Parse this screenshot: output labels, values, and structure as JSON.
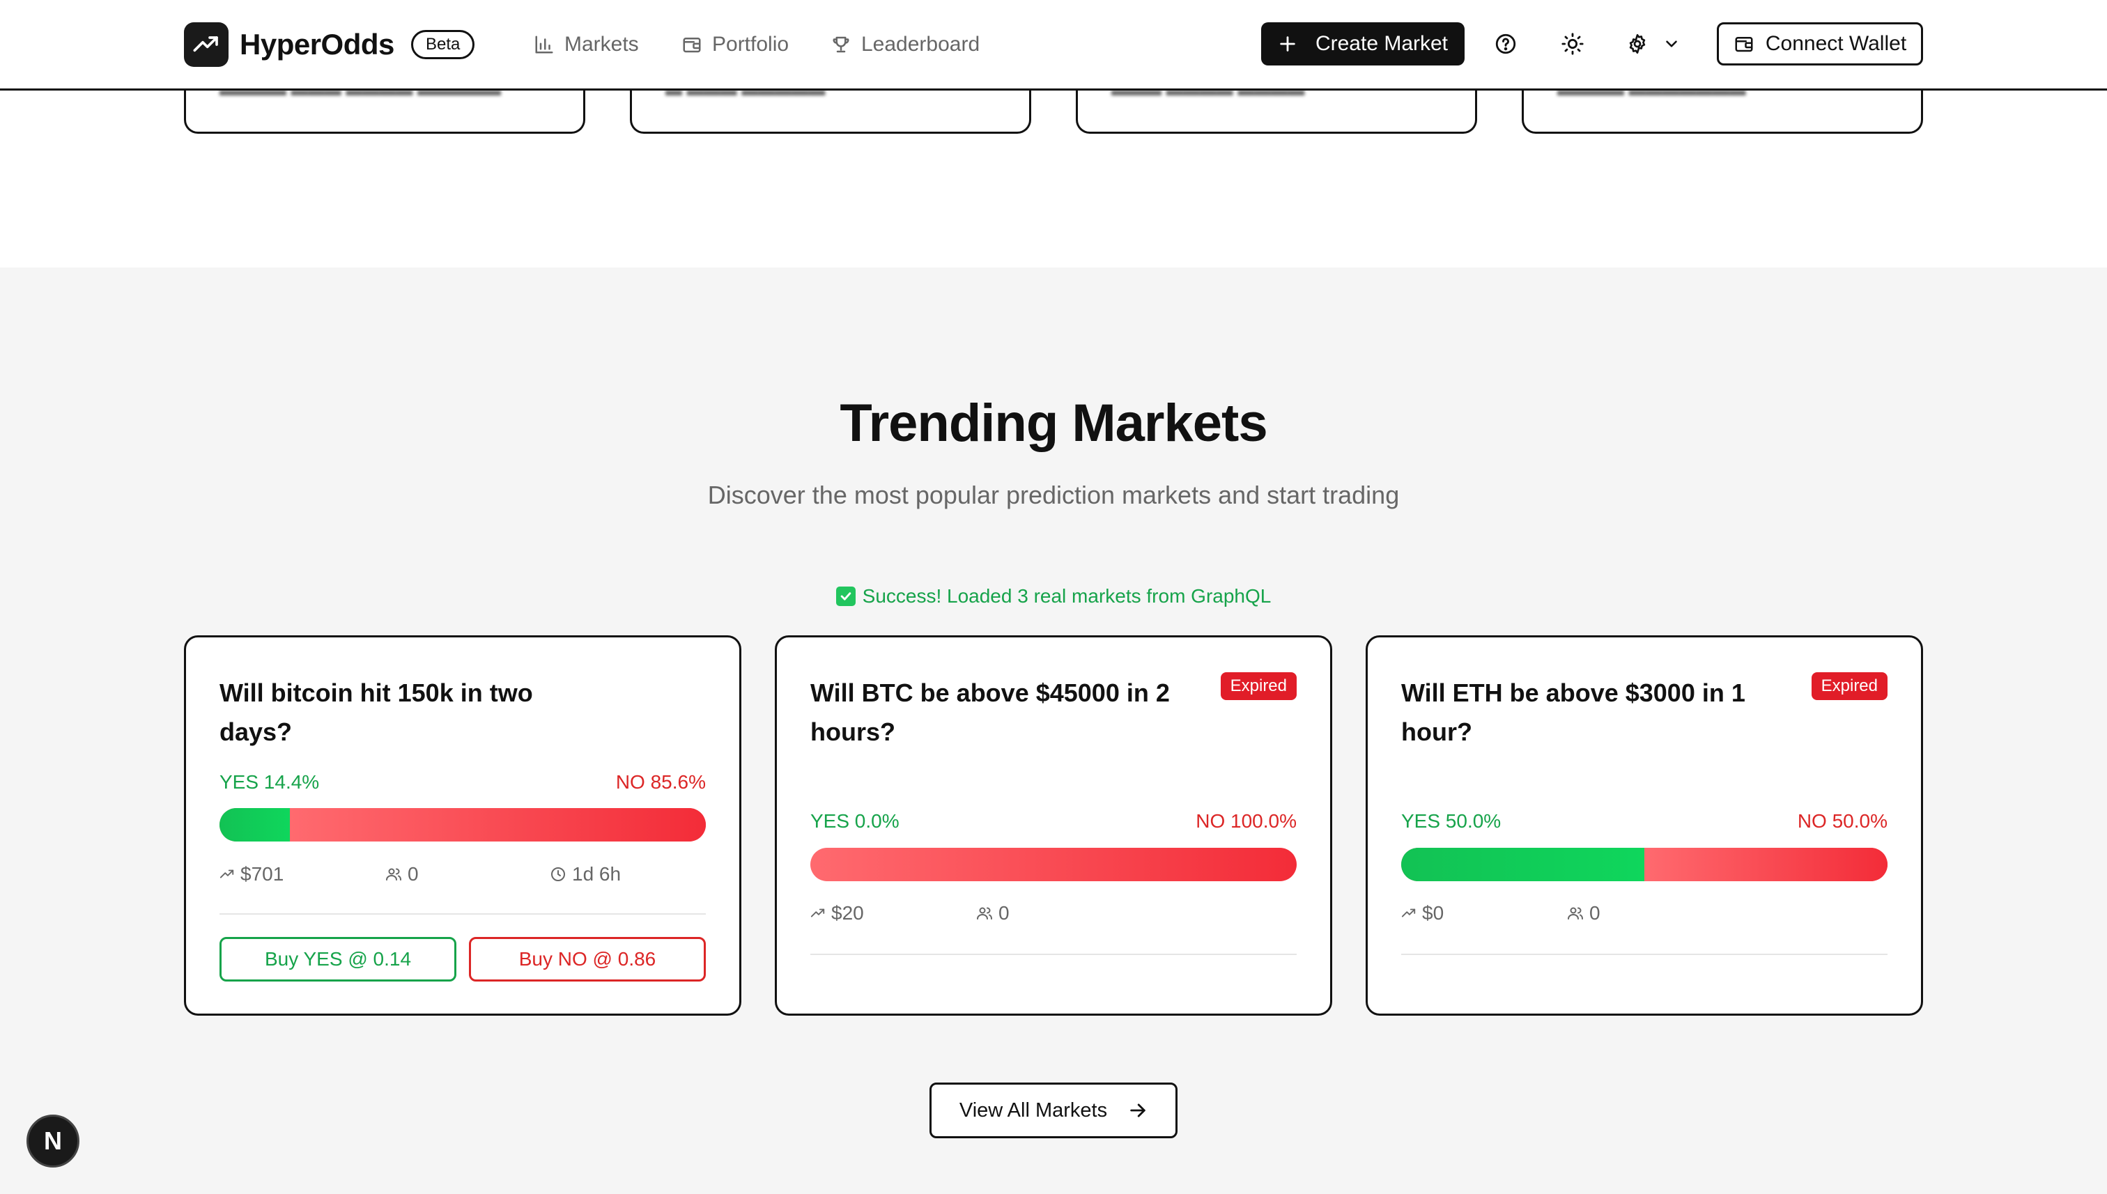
{
  "brand": {
    "name": "HyperOdds",
    "badge": "Beta"
  },
  "nav": {
    "items": [
      {
        "label": "Markets",
        "icon": "bar-chart-icon"
      },
      {
        "label": "Portfolio",
        "icon": "wallet-icon"
      },
      {
        "label": "Leaderboard",
        "icon": "trophy-icon"
      }
    ]
  },
  "header": {
    "create_label": "Create Market",
    "connect_label": "Connect Wallet"
  },
  "trending": {
    "title": "Trending Markets",
    "subtitle": "Discover the most popular prediction markets and start trading",
    "success_message": "Success! Loaded 3 real markets from GraphQL",
    "view_all_label": "View All Markets"
  },
  "markets": [
    {
      "question": "Will bitcoin hit 150k in two days?",
      "expired": false,
      "yes_label": "YES 14.4%",
      "no_label": "NO 85.6%",
      "yes_pct": 14.4,
      "volume": "$701",
      "traders": "0",
      "time_left": "1d 6h",
      "buy_yes_label": "Buy YES @ 0.14",
      "buy_no_label": "Buy NO @ 0.86"
    },
    {
      "question": "Will BTC be above $45000 in 2 hours?",
      "expired": true,
      "badge": "Expired",
      "yes_label": "YES 0.0%",
      "no_label": "NO 100.0%",
      "yes_pct": 0,
      "volume": "$20",
      "traders": "0"
    },
    {
      "question": "Will ETH be above $3000 in 1 hour?",
      "expired": true,
      "badge": "Expired",
      "yes_label": "YES 50.0%",
      "no_label": "NO 50.0%",
      "yes_pct": 50,
      "volume": "$0",
      "traders": "0"
    }
  ],
  "colors": {
    "yes": "#16a34a",
    "no": "#dc2626",
    "expired_badge": "#e11d28",
    "section_bg": "#f5f5f5",
    "primary_button": "#111111"
  },
  "dev_badge": {
    "letter": "N"
  }
}
